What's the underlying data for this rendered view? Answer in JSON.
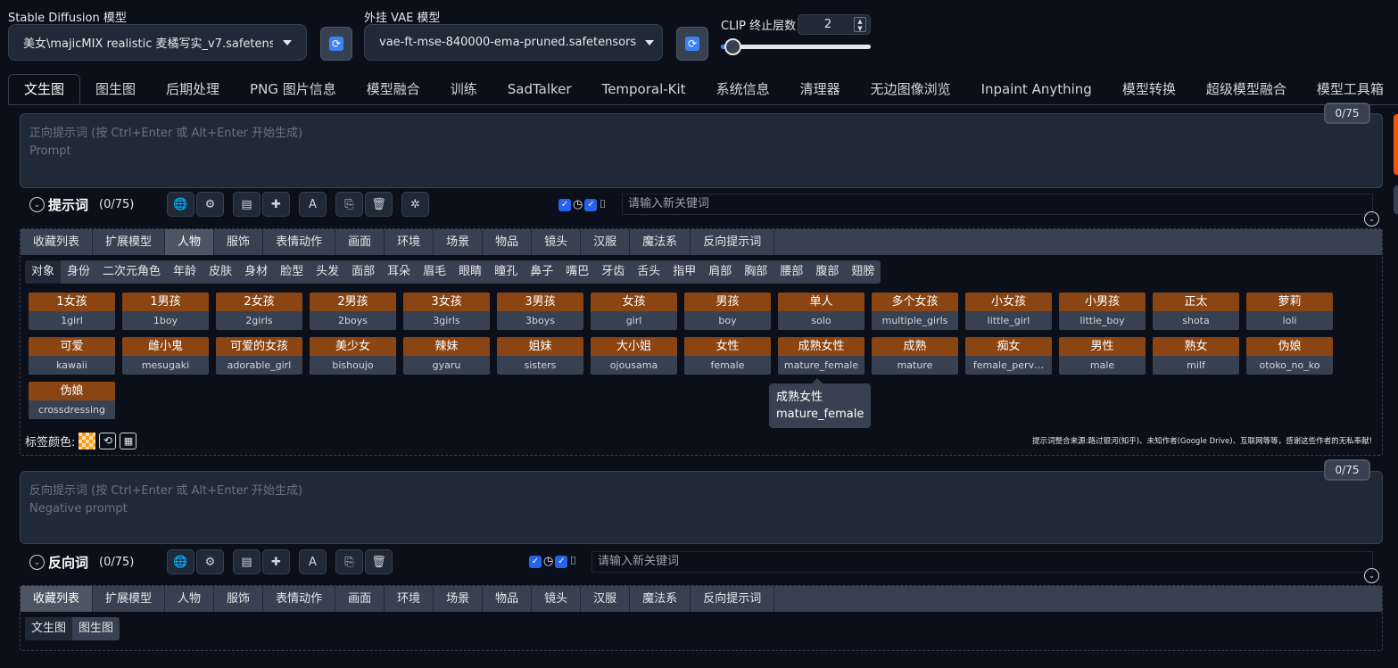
{
  "header": {
    "sd_model_label": "Stable Diffusion 模型",
    "sd_model_value": "美女\\majicMIX realistic 麦橘写实_v7.safetensors",
    "vae_label": "外挂 VAE 模型",
    "vae_value": "vae-ft-mse-840000-ema-pruned.safetensors",
    "clip_label": "CLIP 终止层数",
    "clip_value": "2",
    "clip_slider_fraction": 0.08,
    "refresh_icon": "⟳"
  },
  "tabs": [
    "文生图",
    "图生图",
    "后期处理",
    "PNG 图片信息",
    "模型融合",
    "训练",
    "SadTalker",
    "Temporal-Kit",
    "系统信息",
    "清理器",
    "无边图像浏览",
    "Inpaint Anything",
    "模型转换",
    "超级模型融合",
    "模型工具箱"
  ],
  "positive": {
    "placeholder_line1": "正向提示词 (按 Ctrl+Enter 或 Alt+Enter 开始生成)",
    "placeholder_line2": "Prompt",
    "counter": "0/75",
    "section_title": "提示词",
    "section_count": "(0/75)",
    "keyword_placeholder": "请输入新关键词"
  },
  "categories": [
    "收藏列表",
    "扩展模型",
    "人物",
    "服饰",
    "表情动作",
    "画面",
    "环境",
    "场景",
    "物品",
    "镜头",
    "汉服",
    "魔法系",
    "反向提示词"
  ],
  "subcategories": [
    "对象",
    "身份",
    "二次元角色",
    "年龄",
    "皮肤",
    "身材",
    "脸型",
    "头发",
    "面部",
    "耳朵",
    "眉毛",
    "眼睛",
    "瞳孔",
    "鼻子",
    "嘴巴",
    "牙齿",
    "舌头",
    "指甲",
    "肩部",
    "胸部",
    "腰部",
    "腹部",
    "翅膀"
  ],
  "tags": [
    {
      "cn": "1女孩",
      "en": "1girl"
    },
    {
      "cn": "1男孩",
      "en": "1boy"
    },
    {
      "cn": "2女孩",
      "en": "2girls"
    },
    {
      "cn": "2男孩",
      "en": "2boys"
    },
    {
      "cn": "3女孩",
      "en": "3girls"
    },
    {
      "cn": "3男孩",
      "en": "3boys"
    },
    {
      "cn": "女孩",
      "en": "girl"
    },
    {
      "cn": "男孩",
      "en": "boy"
    },
    {
      "cn": "单人",
      "en": "solo"
    },
    {
      "cn": "多个女孩",
      "en": "multiple_girls"
    },
    {
      "cn": "小女孩",
      "en": "little_girl"
    },
    {
      "cn": "小男孩",
      "en": "little_boy"
    },
    {
      "cn": "正太",
      "en": "shota"
    },
    {
      "cn": "萝莉",
      "en": "loli"
    },
    {
      "cn": "可爱",
      "en": "kawaii"
    },
    {
      "cn": "雌小鬼",
      "en": "mesugaki"
    },
    {
      "cn": "可爱的女孩",
      "en": "adorable_girl"
    },
    {
      "cn": "美少女",
      "en": "bishoujo"
    },
    {
      "cn": "辣妹",
      "en": "gyaru"
    },
    {
      "cn": "姐妹",
      "en": "sisters"
    },
    {
      "cn": "大小姐",
      "en": "ojousama"
    },
    {
      "cn": "女性",
      "en": "female"
    },
    {
      "cn": "成熟女性",
      "en": "mature_female"
    },
    {
      "cn": "成熟",
      "en": "mature"
    },
    {
      "cn": "痴女",
      "en": "female_perv…"
    },
    {
      "cn": "男性",
      "en": "male"
    },
    {
      "cn": "熟女",
      "en": "milf"
    },
    {
      "cn": "伪娘",
      "en": "otoko_no_ko"
    },
    {
      "cn": "伪娘",
      "en": "crossdressing"
    }
  ],
  "tooltip": {
    "line1": "成熟女性",
    "line2": "mature_female"
  },
  "tag_color_label": "标签颜色:",
  "credits": "提示词整合来源:路过银河(知乎)、未知作者(Google Drive)、互联网等等，感谢这些作者的无私奉献!",
  "negative": {
    "placeholder_line1": "反向提示词 (按 Ctrl+Enter 或 Alt+Enter 开始生成)",
    "placeholder_line2": "Negative prompt",
    "counter": "0/75",
    "section_title": "反向词",
    "section_count": "(0/75)",
    "keyword_placeholder": "请输入新关键词"
  },
  "neg_subtabs": [
    "文生图",
    "图生图"
  ],
  "colors": {
    "tag_top": "#8b4513",
    "accent": "#2563eb",
    "bg": "#0b0f19"
  }
}
